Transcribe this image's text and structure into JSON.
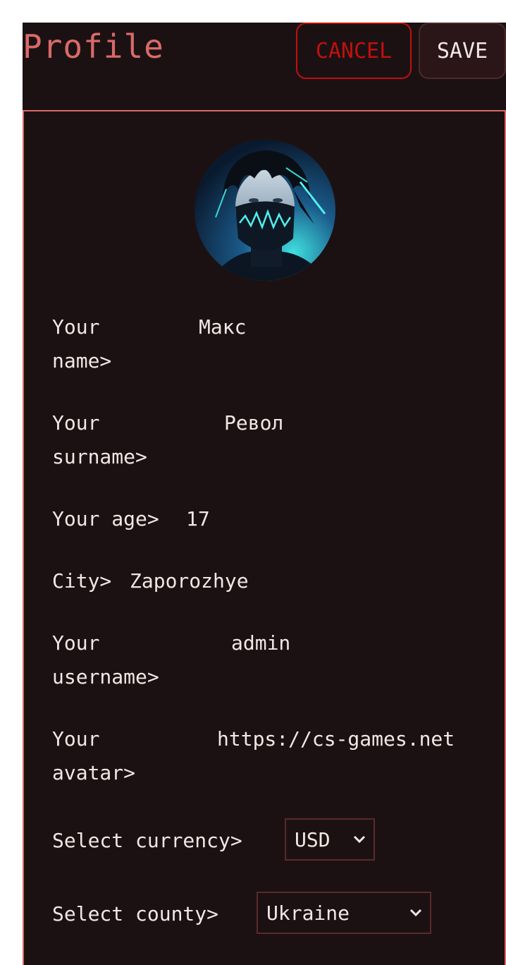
{
  "header": {
    "title": "Profile",
    "cancel_label": "CANCEL",
    "save_label": "SAVE"
  },
  "profile": {
    "avatar_alt": "avatar",
    "fields": {
      "name": {
        "label_line1": "Your",
        "label_line2": "name>",
        "value": "Макс"
      },
      "surname": {
        "label_line1": "Your",
        "label_line2": "surname>",
        "value": "Револ"
      },
      "age": {
        "label": "Your age>",
        "value": "17"
      },
      "city": {
        "label": "City>",
        "value": "Zaporozhye"
      },
      "username": {
        "label_line1": "Your",
        "label_line2": "username>",
        "value": "admin"
      },
      "avatar": {
        "label_line1": "Your",
        "label_line2": "avatar>",
        "value": "https://cs-games.net"
      }
    },
    "currency": {
      "label": "Select currency>",
      "selected": "USD"
    },
    "country": {
      "label": "Select county>",
      "selected": "Ukraine"
    }
  },
  "colors": {
    "background": "#1c1112",
    "accent": "#d96a6a",
    "cancel": "#c01010",
    "text": "#f2e6e6"
  }
}
